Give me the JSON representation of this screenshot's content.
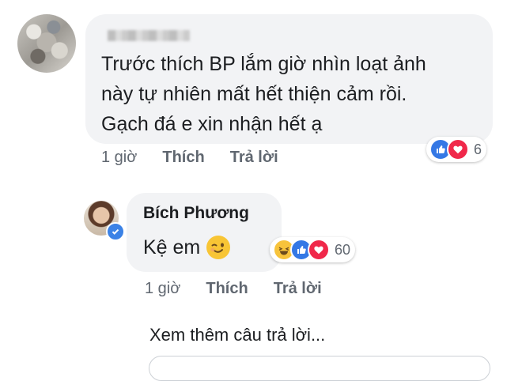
{
  "comment": {
    "text_lines": [
      "Trước thích BP lắm giờ nhìn loạt ảnh",
      "này tự nhiên mất hết thiện cảm rồi.",
      "Gạch đá e xin nhận hết ạ"
    ],
    "time": "1 giờ",
    "like_label": "Thích",
    "reply_label": "Trả lời",
    "reaction_icons": [
      "like-icon",
      "love-icon"
    ],
    "reaction_count": "6"
  },
  "reply": {
    "author": "Bích Phương",
    "text": "Kệ em",
    "emoji": "wink-emoji",
    "time": "1 giờ",
    "like_label": "Thích",
    "reply_label": "Trả lời",
    "reaction_icons": [
      "haha-icon",
      "like-icon",
      "love-icon"
    ],
    "reaction_count": "60"
  },
  "view_more_label": "Xem thêm câu trả lời...",
  "colors": {
    "bubble": "#f2f3f5",
    "text": "#1c1e21",
    "meta": "#606770",
    "like": "#3578e5",
    "love": "#f0284a",
    "haha": "#f7c33b"
  }
}
